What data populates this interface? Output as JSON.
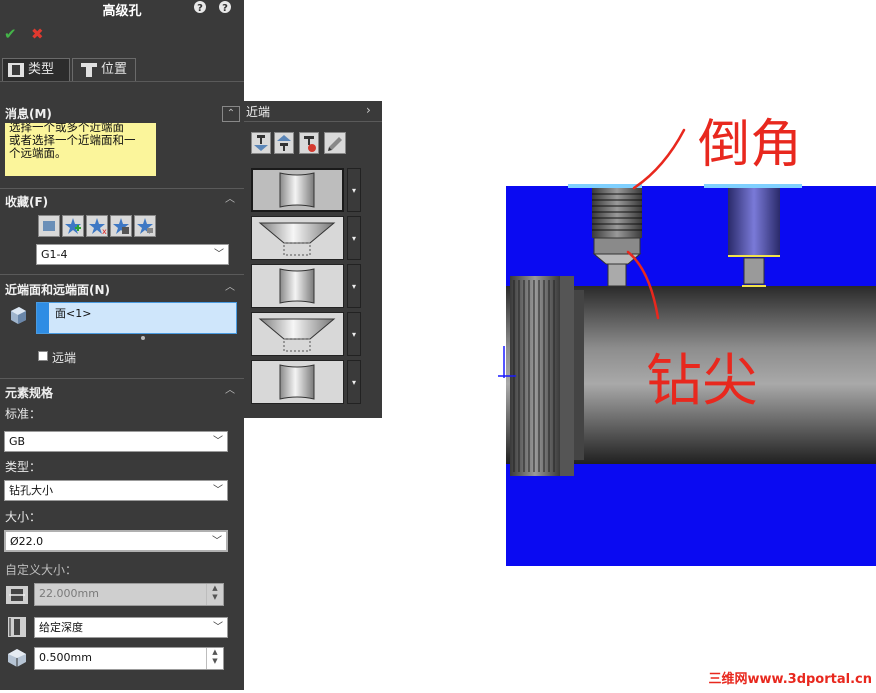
{
  "panel": {
    "title": "高级孔",
    "tabs": [
      {
        "label": "类型"
      },
      {
        "label": "位置"
      }
    ],
    "message": {
      "header": "消息(M)",
      "text_lines": [
        "选择一个或多个近端面",
        "或者选择一个近端面和一",
        "个远端面。"
      ]
    },
    "favorites": {
      "header": "收藏(F)",
      "selected": "G1-4"
    },
    "faces": {
      "header": "近端面和远端面(N)",
      "item": "面<1>",
      "far_label": "远端"
    },
    "spec": {
      "header": "元素规格",
      "standard_label": "标准：",
      "standard": "GB",
      "type_label": "类型：",
      "type": "钻孔大小",
      "size_label": "大小：",
      "size": "Ø22.0",
      "custom_label": "自定义大小：",
      "custom_value": "22.000mm",
      "end_condition": "给定深度",
      "depth": "0.500mm"
    }
  },
  "flyout": {
    "title": "近端"
  },
  "annotations": {
    "chamfer": "倒角",
    "drill_tip": "钻尖"
  },
  "watermark": "三维网www.3dportal.cn",
  "colors": {
    "panel_bg": "#3a3a3a",
    "message_bg": "#fbf59b",
    "part_blue": "#0a0af2",
    "annotation_red": "#e8281e",
    "selection_blue": "#cfe6fb"
  }
}
